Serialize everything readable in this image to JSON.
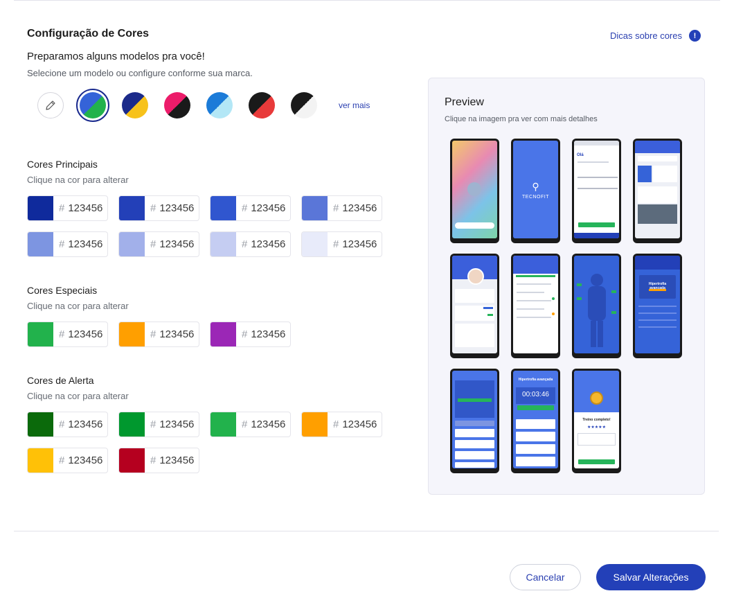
{
  "header": {
    "title": "Configuração de Cores",
    "tips_link": "Dicas sobre cores",
    "tips_icon": "!"
  },
  "templates": {
    "heading": "Preparamos alguns modelos pra você!",
    "subtitle": "Selecione um modelo ou configure conforme sua marca.",
    "see_more": "ver mais",
    "presets": [
      {
        "name": "blue-green",
        "a": "#3563d8",
        "b": "#22b24c",
        "selected": true
      },
      {
        "name": "navy-yellow",
        "a": "#1b2a8a",
        "b": "#f7c21b",
        "selected": false
      },
      {
        "name": "pink-black",
        "a": "#ec1c6a",
        "b": "#1a1a1a",
        "selected": false
      },
      {
        "name": "blue-lightblue",
        "a": "#1b7bd8",
        "b": "#b3e7f6",
        "selected": false
      },
      {
        "name": "black-red",
        "a": "#1a1a1a",
        "b": "#e83a3a",
        "selected": false
      },
      {
        "name": "black-white",
        "a": "#1a1a1a",
        "b": "#f3f3f3",
        "selected": false
      }
    ]
  },
  "main_colors": {
    "title": "Cores Principais",
    "subtitle": "Clique na cor para alterar",
    "swatches": [
      {
        "color": "#0f2a9c",
        "hash": "#",
        "value": "123456"
      },
      {
        "color": "#2340b8",
        "hash": "#",
        "value": "123456"
      },
      {
        "color": "#3056cf",
        "hash": "#",
        "value": "123456"
      },
      {
        "color": "#5a76d8",
        "hash": "#",
        "value": "123456"
      },
      {
        "color": "#7d95e1",
        "hash": "#",
        "value": "123456"
      },
      {
        "color": "#a2b0ea",
        "hash": "#",
        "value": "123456"
      },
      {
        "color": "#c5cdf2",
        "hash": "#",
        "value": "123456"
      },
      {
        "color": "#e8ebfa",
        "hash": "#",
        "value": "123456"
      }
    ]
  },
  "special_colors": {
    "title": "Cores Especiais",
    "subtitle": "Clique na cor para alterar",
    "swatches": [
      {
        "color": "#22b24c",
        "hash": "#",
        "value": "123456"
      },
      {
        "color": "#ff9f00",
        "hash": "#",
        "value": "123456"
      },
      {
        "color": "#9b27b6",
        "hash": "#",
        "value": "123456"
      }
    ]
  },
  "alert_colors": {
    "title": "Cores de Alerta",
    "subtitle": "Clique na cor para alterar",
    "swatches": [
      {
        "color": "#0b6a0b",
        "hash": "#",
        "value": "123456"
      },
      {
        "color": "#00982e",
        "hash": "#",
        "value": "123456"
      },
      {
        "color": "#22b24c",
        "hash": "#",
        "value": "123456"
      },
      {
        "color": "#ff9f00",
        "hash": "#",
        "value": "123456"
      },
      {
        "color": "#ffc107",
        "hash": "#",
        "value": "123456"
      },
      {
        "color": "#b5001f",
        "hash": "#",
        "value": "123456"
      }
    ]
  },
  "preview": {
    "title": "Preview",
    "subtitle": "Clique na imagem pra ver com mais detalhes",
    "splash_brand": "TECNOFIT",
    "login_heading": "Olá",
    "plan_title": "Hipertrofia avançada",
    "timer": "00:03:46",
    "done_title": "Treino completo!",
    "stars": "★★★★★"
  },
  "footer": {
    "cancel": "Cancelar",
    "save": "Salvar Alterações"
  }
}
